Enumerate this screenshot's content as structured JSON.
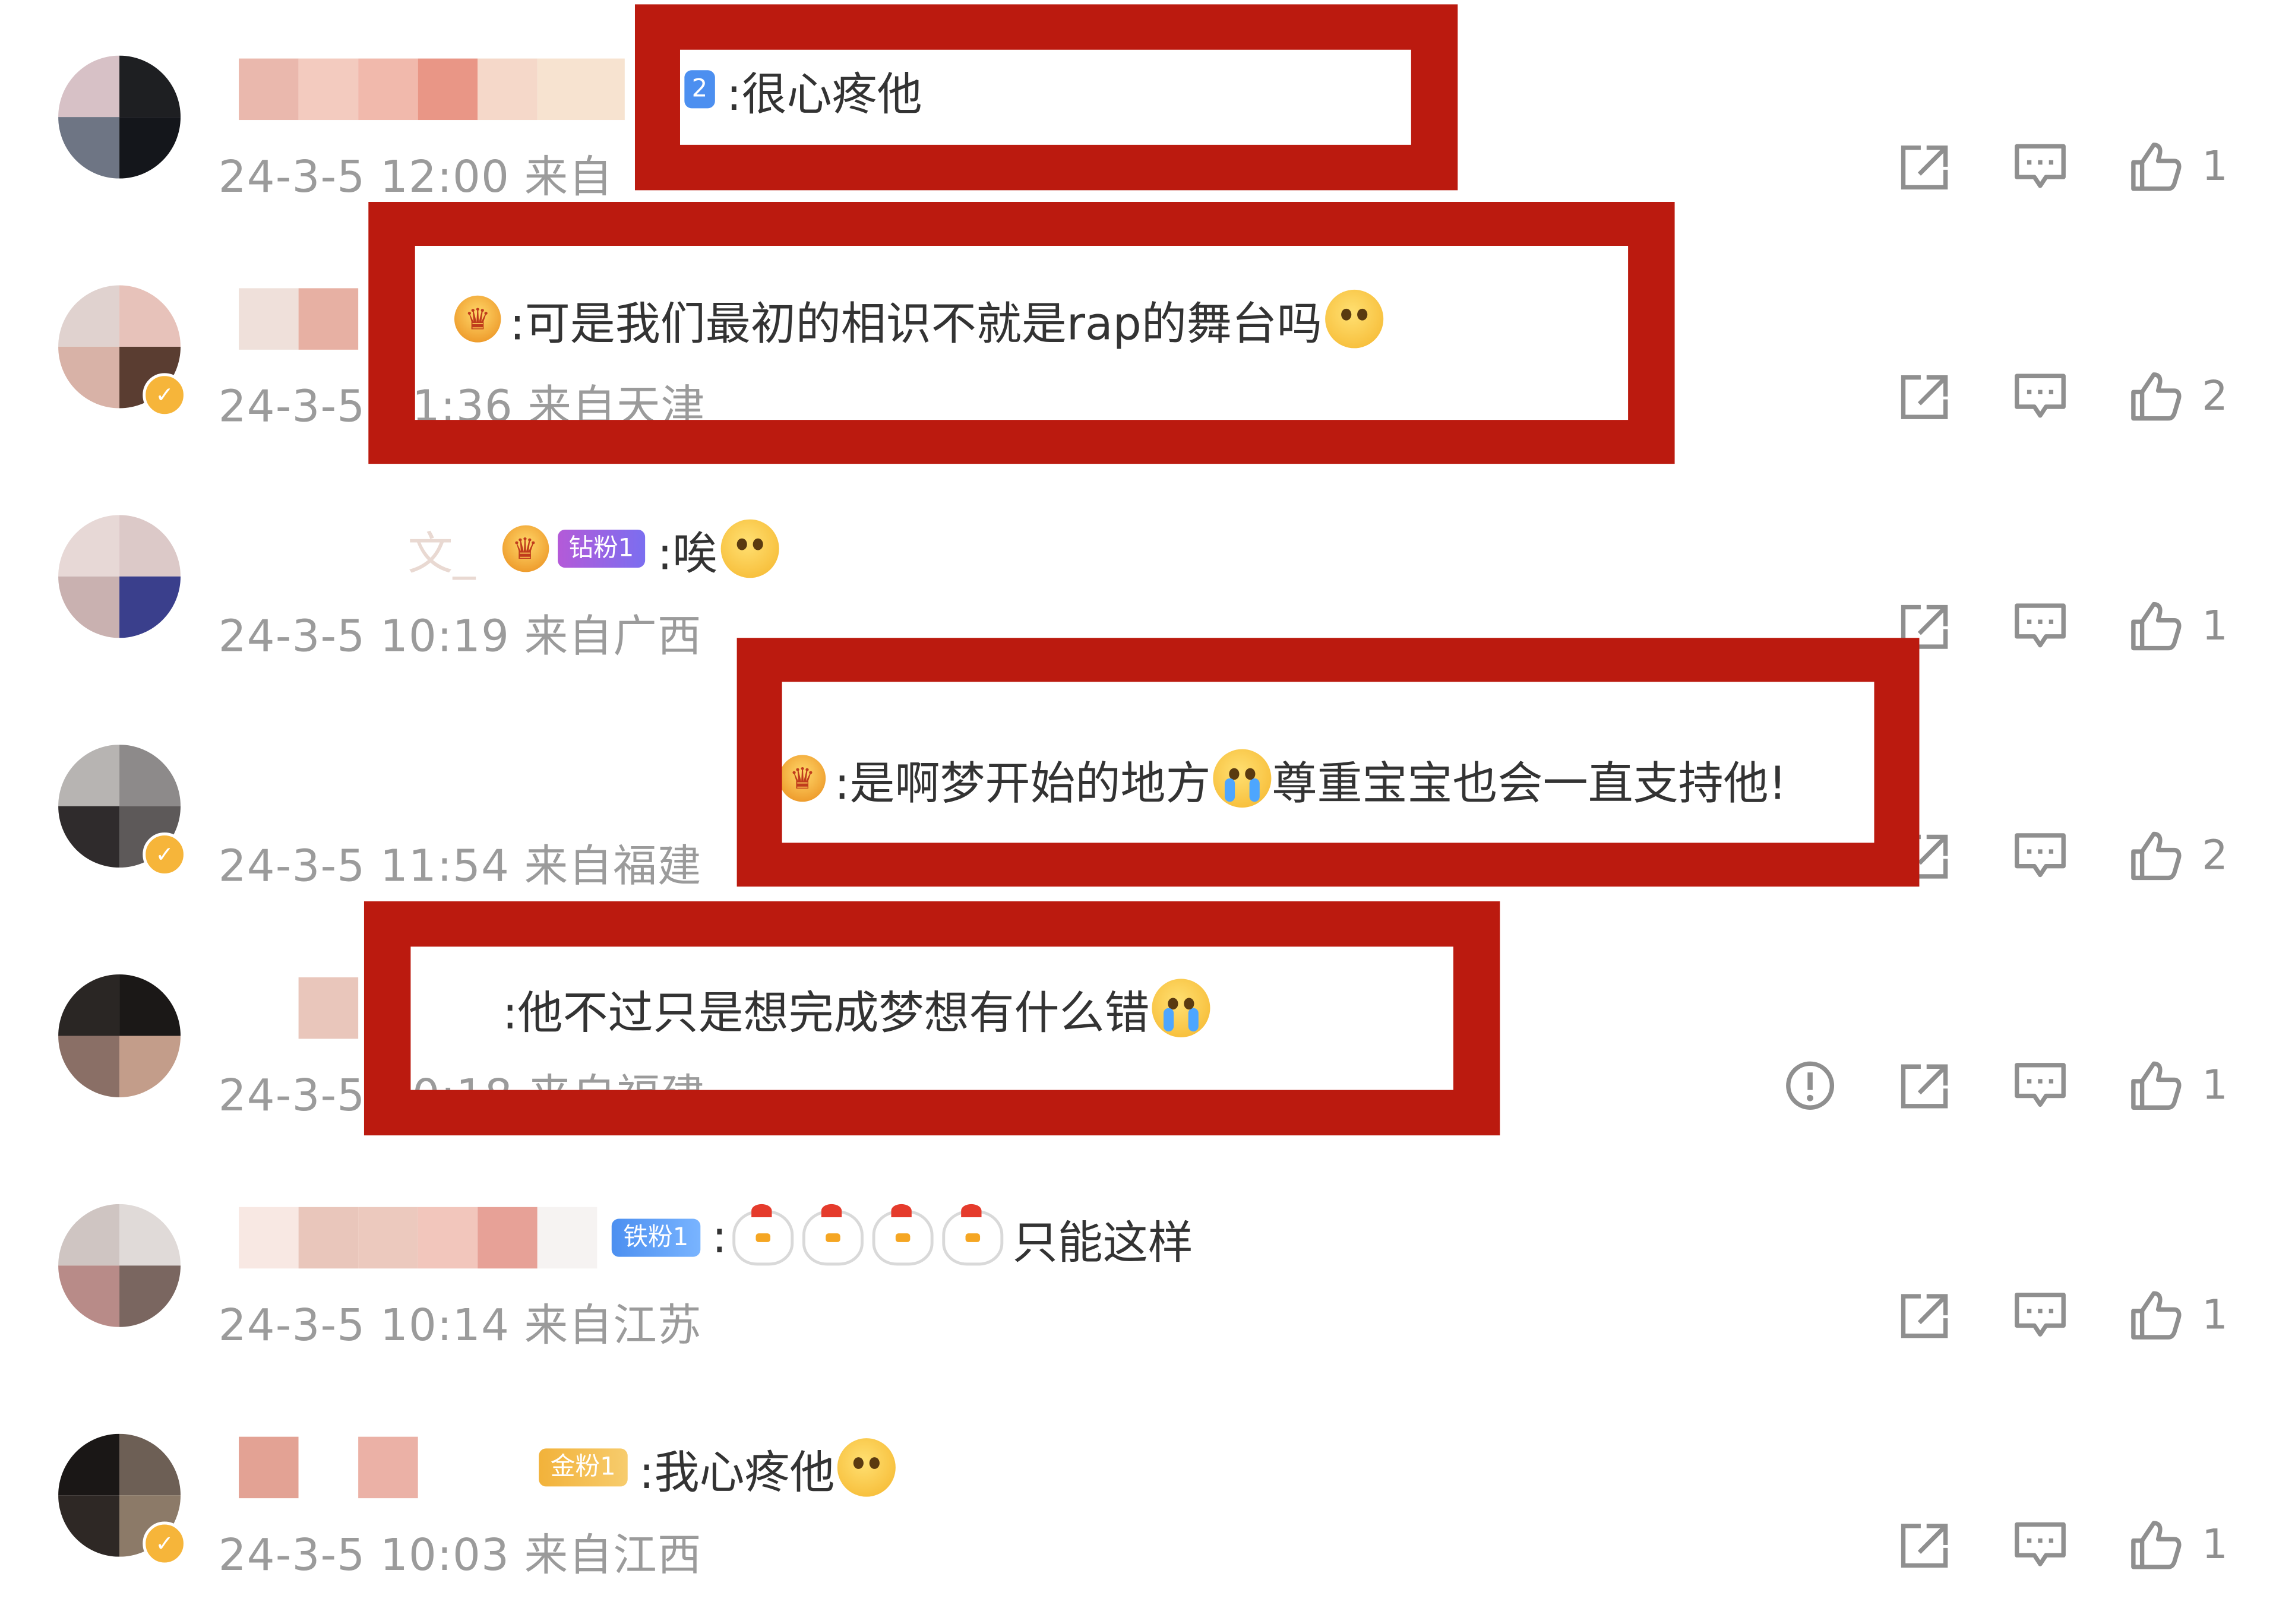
{
  "colors": {
    "annotation_red": "#bb1a0f",
    "meta_gray": "#9b9b9b",
    "icon_gray": "#8f8f8f",
    "fan_blue": "#4c8ff0",
    "fan_purple": "#9b59e0",
    "fan_gold": "#f2b23a"
  },
  "comments": [
    {
      "badge": "2",
      "text": ":很心疼他",
      "time": "24-3-5 12:00",
      "location": "来自",
      "likes": "1",
      "icons": [
        "share-icon",
        "reply-icon",
        "like-icon"
      ]
    },
    {
      "text": ":可是我们最初的相识不就是rap的舞台吗",
      "time": "24-3-5",
      "time_rest": "1:36",
      "location": "来自天津",
      "likes": "2",
      "verified": true
    },
    {
      "name_fragment": "文_",
      "badge": "钻粉1",
      "text": ":唉",
      "time": "24-3-5 10:19",
      "location": "来自广西",
      "likes": "1"
    },
    {
      "text": ":是啊梦开始的地方",
      "text_after": "尊重宝宝也会一直支持他!",
      "time": "24-3-5 11:54",
      "location": "来自福建",
      "likes": "2",
      "verified": true
    },
    {
      "text": ":他不过只是想完成梦想有什么错",
      "time": "24-3-5",
      "time_rest": "0:18",
      "location": "来自福建",
      "likes": "1",
      "report_icon": "alert-circle-icon"
    },
    {
      "badge": "铁粉1",
      "text": "只能这样",
      "prefix": ":",
      "time": "24-3-5 10:14",
      "location": "来自江苏",
      "likes": "1"
    },
    {
      "badge": "金粉1",
      "text": ":我心疼他",
      "time": "24-3-5 10:03",
      "location": "来自江西",
      "likes": "1",
      "verified": true
    }
  ]
}
